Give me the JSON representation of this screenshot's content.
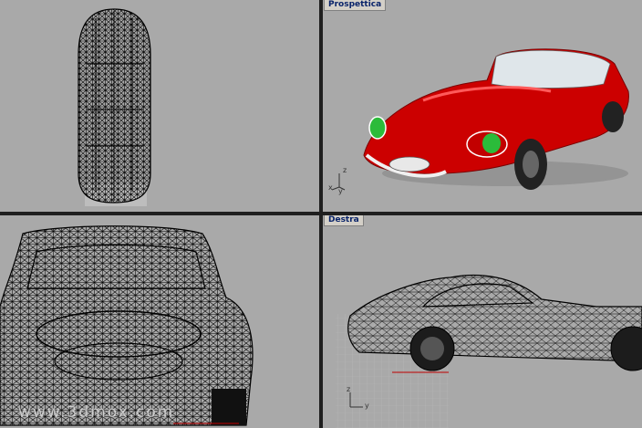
{
  "viewports": {
    "top": {
      "label": ""
    },
    "perspective": {
      "label": "Prospettica",
      "axis_x": "x",
      "axis_y": "y",
      "axis_z": "z"
    },
    "front": {
      "label": ""
    },
    "right": {
      "label": "Destra",
      "axis_z": "z",
      "axis_y": "y"
    }
  },
  "watermark": {
    "text": "www.3dmox.com"
  },
  "colors": {
    "viewport_bg": "#a9a9a9",
    "car_body": "#cc0000",
    "headlight": "#2bbb3a",
    "wireframe": "#000000",
    "label_bg": "#d4d0c8",
    "axis_red": "#c00000"
  }
}
